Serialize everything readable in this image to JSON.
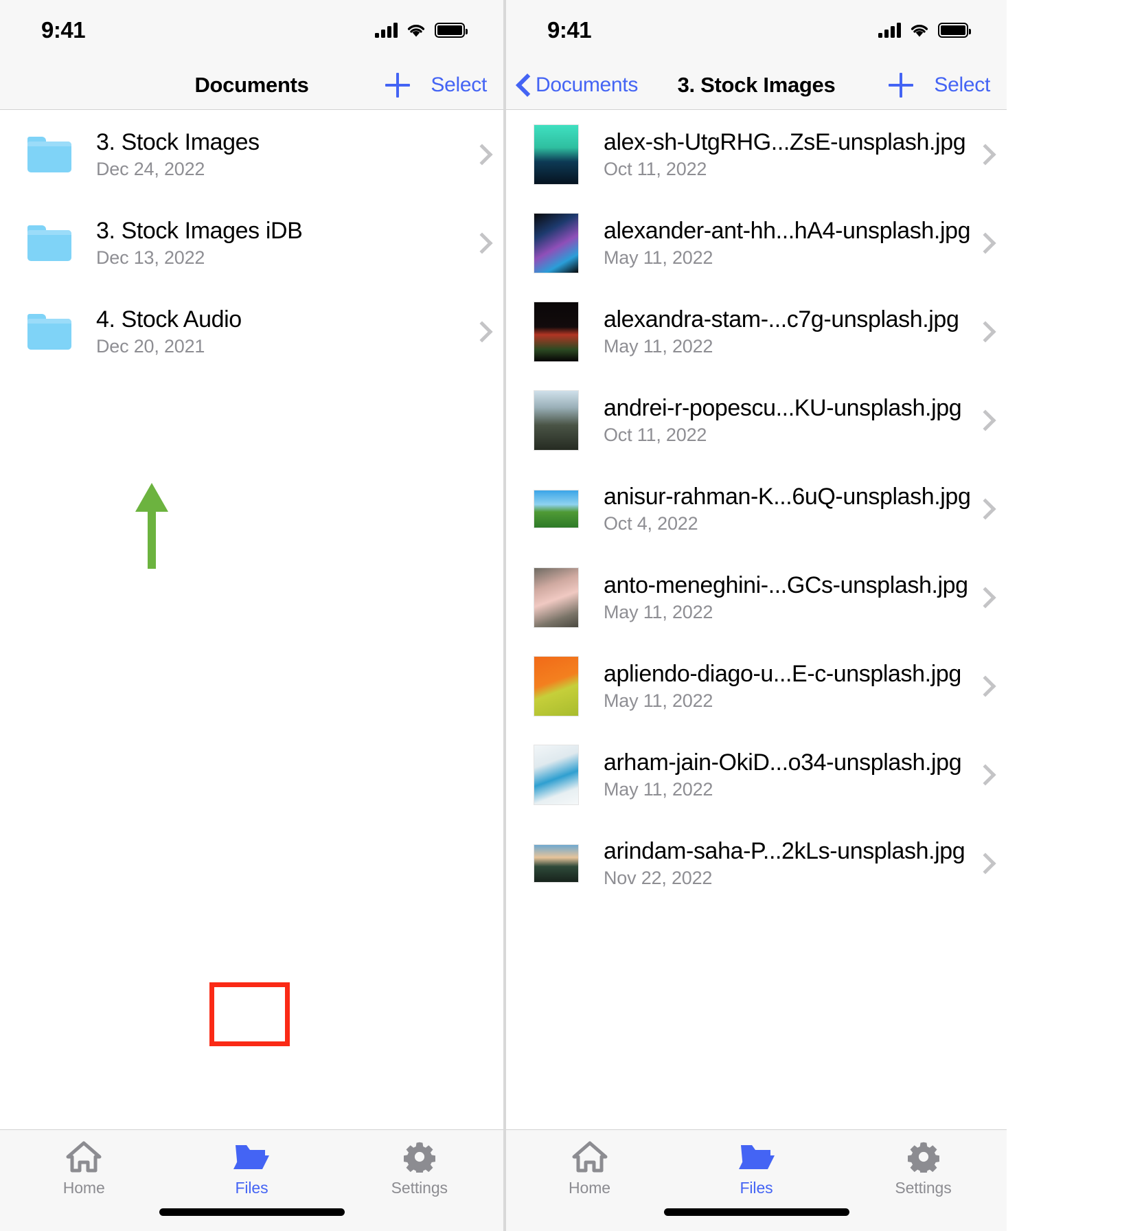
{
  "status_bar": {
    "time": "9:41",
    "icons": [
      "cellular-signal-icon",
      "wifi-icon",
      "battery-icon"
    ]
  },
  "colors": {
    "accent_blue": "#4464f4",
    "folder_blue": "#7fd3f7",
    "annotation_red": "#fa2a16",
    "annotation_green": "#6cb33f",
    "secondary_text": "#8e8e93",
    "bar_background": "#f7f7f7"
  },
  "left_screen": {
    "navbar": {
      "title": "Documents",
      "add_label": "add-icon",
      "select_label": "Select"
    },
    "folders": [
      {
        "name": "3. Stock Images",
        "date": "Dec 24, 2022"
      },
      {
        "name": "3. Stock Images iDB",
        "date": "Dec 13, 2022"
      },
      {
        "name": "4. Stock Audio",
        "date": "Dec 20, 2021"
      }
    ],
    "annotations": {
      "arrow": "green-up-arrow",
      "highlight": "red-box-around-files-tab"
    }
  },
  "right_screen": {
    "navbar": {
      "back_label": "Documents",
      "title": "3. Stock Images",
      "add_label": "add-icon",
      "select_label": "Select"
    },
    "files": [
      {
        "name": "alex-sh-UtgRHG...ZsE-unsplash.jpg",
        "date": "Oct 11, 2022",
        "thumb": "teal-sculpture",
        "orientation": "portrait"
      },
      {
        "name": "alexander-ant-hh...hA4-unsplash.jpg",
        "date": "May 11, 2022",
        "thumb": "dark-confetti",
        "orientation": "portrait"
      },
      {
        "name": "alexandra-stam-...c7g-unsplash.jpg",
        "date": "May 11, 2022",
        "thumb": "red-tulip-dark",
        "orientation": "portrait"
      },
      {
        "name": "andrei-r-popescu...KU-unsplash.jpg",
        "date": "Oct 11, 2022",
        "thumb": "snowy-mountain",
        "orientation": "portrait"
      },
      {
        "name": "anisur-rahman-K...6uQ-unsplash.jpg",
        "date": "Oct 4, 2022",
        "thumb": "green-field-road",
        "orientation": "landscape"
      },
      {
        "name": "anto-meneghini-...GCs-unsplash.jpg",
        "date": "May 11, 2022",
        "thumb": "pink-blossom-rock",
        "orientation": "portrait"
      },
      {
        "name": "apliendo-diago-u...E-c-unsplash.jpg",
        "date": "May 11, 2022",
        "thumb": "oranges-bananas",
        "orientation": "portrait"
      },
      {
        "name": "arham-jain-OkiD...o34-unsplash.jpg",
        "date": "May 11, 2022",
        "thumb": "blue-blossoms",
        "orientation": "portrait"
      },
      {
        "name": "arindam-saha-P...2kLs-unsplash.jpg",
        "date": "Nov 22, 2022",
        "thumb": "sunset-river",
        "orientation": "landscape"
      }
    ]
  },
  "tab_bar": {
    "items": [
      {
        "label": "Home",
        "icon": "home-icon",
        "active": false
      },
      {
        "label": "Files",
        "icon": "folder-icon",
        "active": true
      },
      {
        "label": "Settings",
        "icon": "gear-icon",
        "active": false
      }
    ]
  }
}
